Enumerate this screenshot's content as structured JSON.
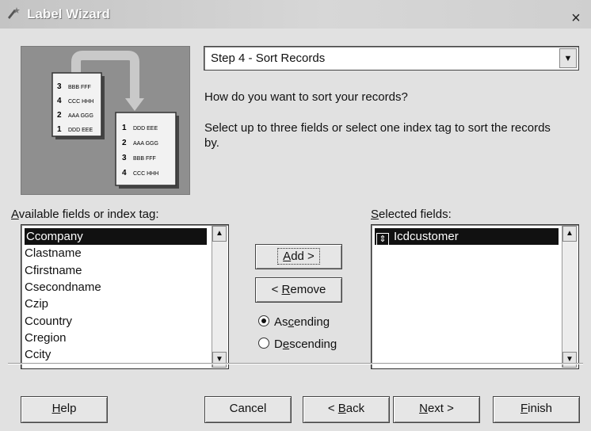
{
  "window": {
    "title": "Label Wizard",
    "close_label": "×"
  },
  "step": {
    "value": "Step 4 - Sort Records"
  },
  "question": "How do you want to sort your records?",
  "instruction": "Select up to three fields or select one index tag to sort the records by.",
  "illustration": {
    "before": [
      {
        "num": "3",
        "text": "BBB FFF"
      },
      {
        "num": "4",
        "text": "CCC HHH"
      },
      {
        "num": "2",
        "text": "AAA GGG"
      },
      {
        "num": "1",
        "text": "DDD EEE"
      }
    ],
    "after": [
      {
        "num": "1",
        "text": "DDD EEE"
      },
      {
        "num": "2",
        "text": "AAA GGG"
      },
      {
        "num": "3",
        "text": "BBB FFF"
      },
      {
        "num": "4",
        "text": "CCC HHH"
      }
    ]
  },
  "available": {
    "label_first": "A",
    "label_rest": "vailable fields or index tag:",
    "items": [
      "Ccompany",
      "Clastname",
      "Cfirstname",
      "Csecondname",
      "Czip",
      "Ccountry",
      "Cregion",
      "Ccity"
    ],
    "selected_index": 0
  },
  "selected": {
    "label_first": "S",
    "label_rest": "elected fields:",
    "items": [
      "Icdcustomer"
    ],
    "move_icon": "updown-move-icon"
  },
  "buttons": {
    "add": {
      "pre": "",
      "key": "A",
      "post": "dd >"
    },
    "remove": {
      "pre": "< ",
      "key": "R",
      "post": "emove"
    },
    "help": {
      "pre": "",
      "key": "H",
      "post": "elp"
    },
    "cancel": {
      "pre": "Cancel",
      "key": "",
      "post": ""
    },
    "back": {
      "pre": "< ",
      "key": "B",
      "post": "ack"
    },
    "next": {
      "pre": "",
      "key": "N",
      "post": "ext >"
    },
    "finish": {
      "pre": "",
      "key": "F",
      "post": "inish"
    }
  },
  "sort_order": {
    "ascending": {
      "pre": "As",
      "key": "c",
      "post": "ending"
    },
    "descending": {
      "pre": "D",
      "key": "e",
      "post": "scending"
    },
    "selected": "ascending"
  }
}
